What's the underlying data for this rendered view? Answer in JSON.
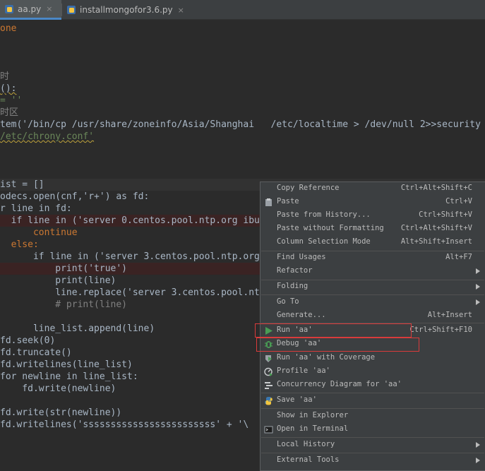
{
  "tabs": [
    {
      "label": "aa.py",
      "close": "×",
      "active": true
    },
    {
      "label": "installmongofor3.6.py",
      "close": "×",
      "active": false
    }
  ],
  "code_lines": [
    "one",
    "",
    "",
    "",
    "时",
    "():",
    "= ''",
    "时区",
    "tem('/bin/cp /usr/share/zoneinfo/Asia/Shanghai   /etc/localtime > /dev/null 2>>security",
    "/etc/chrony.conf'",
    "",
    "",
    "",
    "ist = []",
    "odecs.open(cnf,'r+') as fd:",
    "r line in fd:",
    "  if line in ('server 0.centos.pool.ntp.org ibu",
    "      continue",
    "  else:",
    "      if line in ('server 3.centos.pool.ntp.org",
    "          print('true')",
    "          print(line)",
    "          line.replace('server 3.centos.pool.nt",
    "          # print(line)",
    "",
    "      line_list.append(line)",
    "fd.seek(0)",
    "fd.truncate()",
    "fd.writelines(line_list)",
    "for newline in line_list:",
    "    fd.write(newline)",
    "",
    "fd.write(str(newline))",
    "fd.writelines('ssssssssssssssssssssssss' + '\\"
  ],
  "context_menu": {
    "items": [
      {
        "label": "Copy Reference",
        "shortcut": "Ctrl+Alt+Shift+C",
        "icon": ""
      },
      {
        "label": "Paste",
        "shortcut": "Ctrl+V",
        "icon": "paste-icon"
      },
      {
        "label": "Paste from History...",
        "shortcut": "Ctrl+Shift+V",
        "icon": ""
      },
      {
        "label": "Paste without Formatting",
        "shortcut": "Ctrl+Alt+Shift+V",
        "icon": ""
      },
      {
        "label": "Column Selection Mode",
        "shortcut": "Alt+Shift+Insert",
        "icon": ""
      },
      {
        "label": "Find Usages",
        "shortcut": "Alt+F7",
        "icon": ""
      },
      {
        "label": "Refactor",
        "shortcut": "",
        "icon": "",
        "submenu": true
      },
      {
        "label": "Folding",
        "shortcut": "",
        "icon": "",
        "submenu": true
      },
      {
        "label": "Go To",
        "shortcut": "",
        "icon": "",
        "submenu": true
      },
      {
        "label": "Generate...",
        "shortcut": "Alt+Insert",
        "icon": ""
      },
      {
        "label": "Run 'aa'",
        "shortcut": "Ctrl+Shift+F10",
        "icon": "run-icon"
      },
      {
        "label": "Debug 'aa'",
        "shortcut": "",
        "icon": "debug-icon"
      },
      {
        "label": "Run 'aa' with Coverage",
        "shortcut": "",
        "icon": "coverage-icon"
      },
      {
        "label": "Profile 'aa'",
        "shortcut": "",
        "icon": "profile-icon"
      },
      {
        "label": "Concurrency Diagram for 'aa'",
        "shortcut": "",
        "icon": "concurrency-icon"
      },
      {
        "label": "Save 'aa'",
        "shortcut": "",
        "icon": "python-icon"
      },
      {
        "label": "Show in Explorer",
        "shortcut": "",
        "icon": ""
      },
      {
        "label": "Open in Terminal",
        "shortcut": "",
        "icon": "terminal-icon"
      },
      {
        "label": "Local History",
        "shortcut": "",
        "icon": "",
        "submenu": true
      },
      {
        "label": "External Tools",
        "shortcut": "",
        "icon": "",
        "submenu": true
      }
    ]
  },
  "colors": {
    "background": "#2b2b2b",
    "keyword": "#cc7832",
    "string": "#6a8759",
    "comment": "#808080",
    "menu_bg": "#3c3f41",
    "highlight_box": "#d93b3b",
    "run_green": "#499c54"
  }
}
